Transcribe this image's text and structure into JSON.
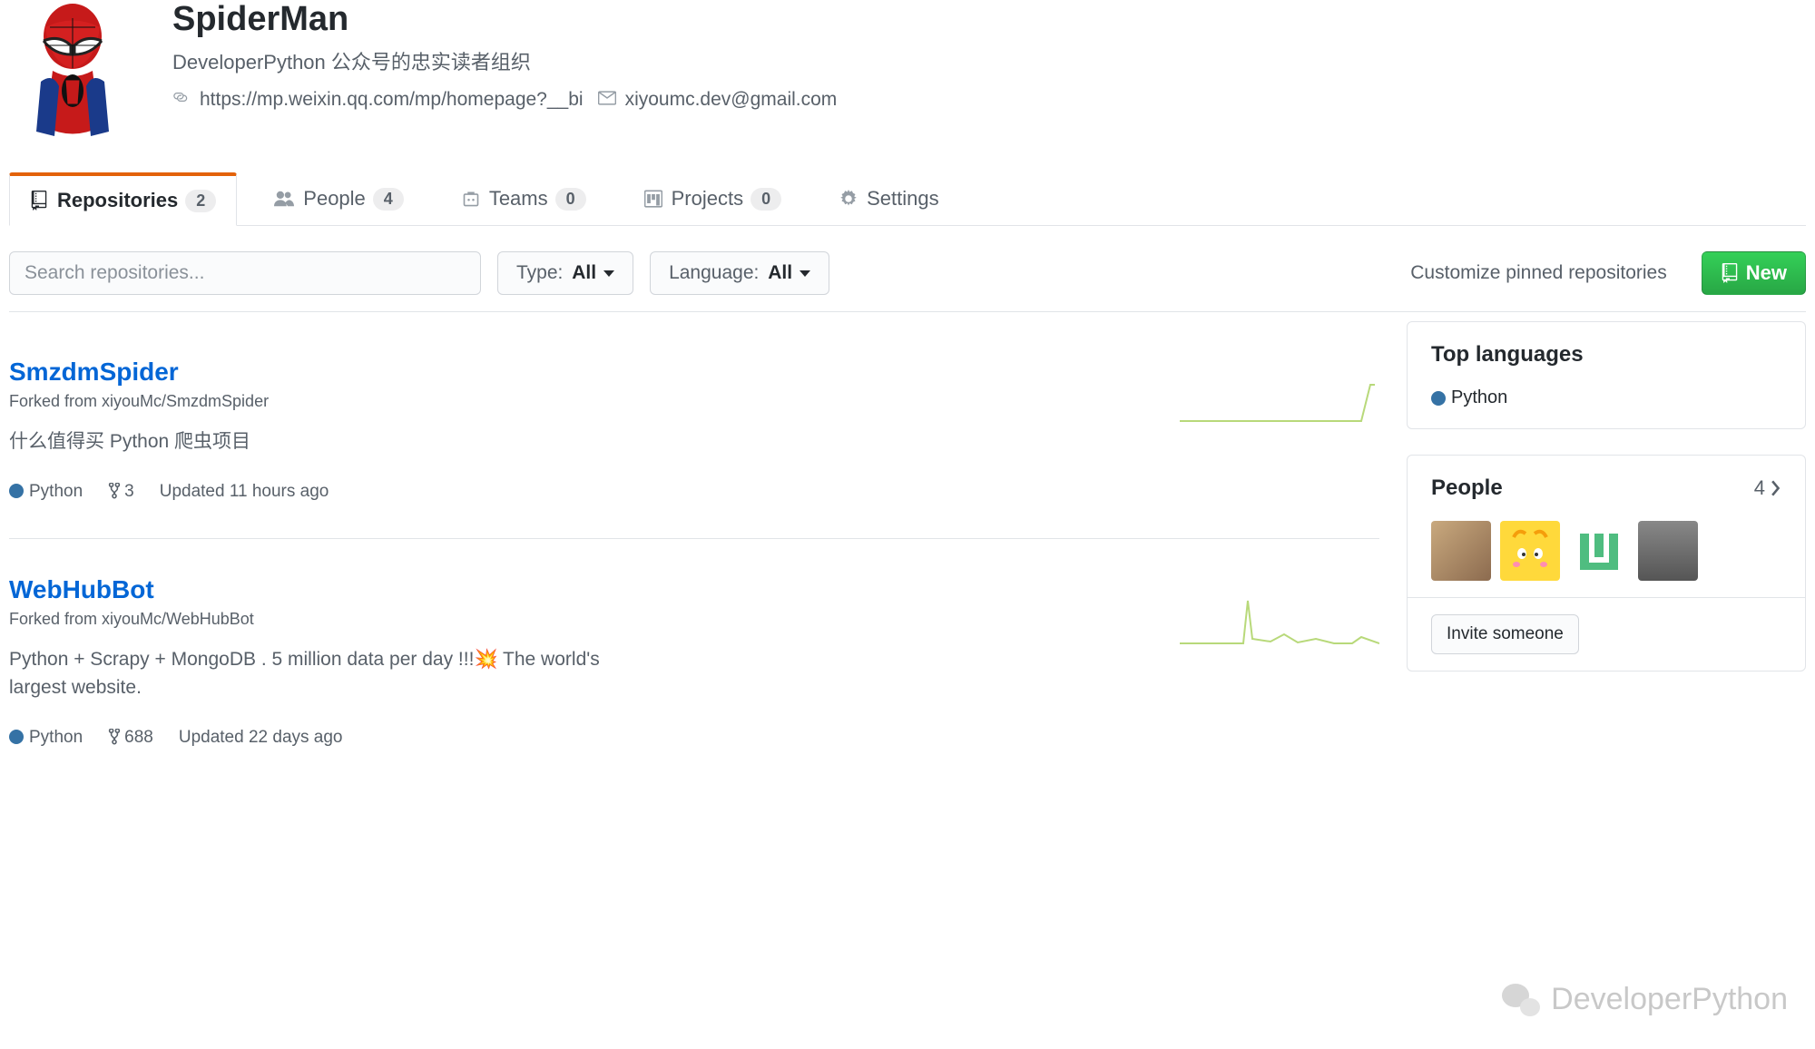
{
  "org": {
    "name": "SpiderMan",
    "description": "DeveloperPython 公众号的忠实读者组织",
    "url": "https://mp.weixin.qq.com/mp/homepage?__bi",
    "email": "xiyoumc.dev@gmail.com"
  },
  "tabs": {
    "repositories": {
      "label": "Repositories",
      "count": "2"
    },
    "people": {
      "label": "People",
      "count": "4"
    },
    "teams": {
      "label": "Teams",
      "count": "0"
    },
    "projects": {
      "label": "Projects",
      "count": "0"
    },
    "settings": {
      "label": "Settings"
    }
  },
  "toolbar": {
    "search_placeholder": "Search repositories...",
    "type_label": "Type:",
    "type_value": "All",
    "language_label": "Language:",
    "language_value": "All",
    "customize": "Customize pinned repositories",
    "new_label": "New"
  },
  "repos": [
    {
      "name": "SmzdmSpider",
      "forked_from": "Forked from xiyouMc/SmzdmSpider",
      "description": "什么值得买 Python 爬虫项目",
      "language": "Python",
      "lang_color": "#3572A5",
      "forks": "3",
      "updated": "Updated 11 hours ago"
    },
    {
      "name": "WebHubBot",
      "forked_from": "Forked from xiyouMc/WebHubBot",
      "description": "Python + Scrapy + MongoDB . 5 million data per day !!!💥 The world's largest website.",
      "language": "Python",
      "lang_color": "#3572A5",
      "forks": "688",
      "updated": "Updated 22 days ago"
    }
  ],
  "sidebar": {
    "top_languages": {
      "title": "Top languages",
      "items": [
        "Python"
      ],
      "color": "#3572A5"
    },
    "people": {
      "title": "People",
      "count": "4",
      "invite_label": "Invite someone"
    }
  },
  "watermark": "DeveloperPython"
}
